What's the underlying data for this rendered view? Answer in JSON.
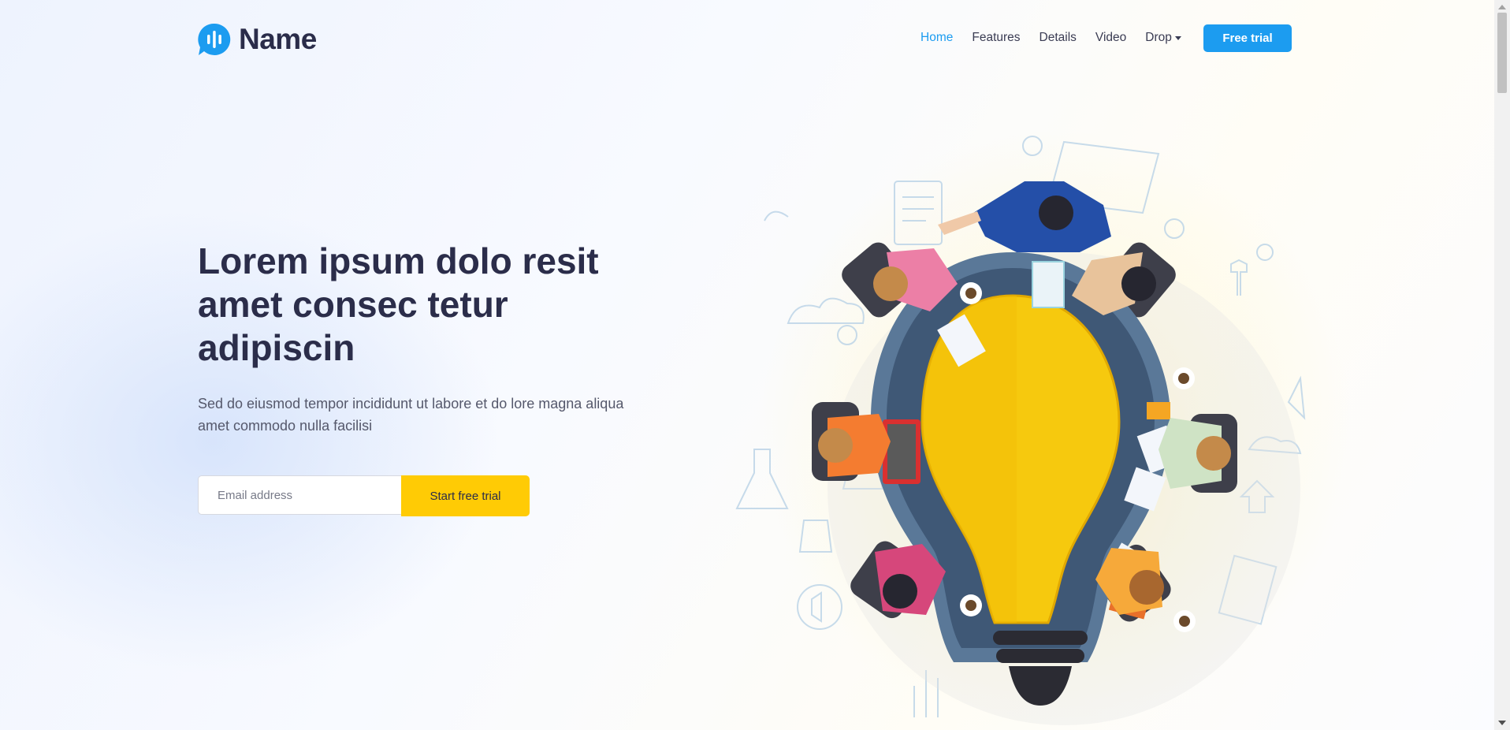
{
  "brand": {
    "name": "Name",
    "icon": "sound-bars-chat-bubble-icon",
    "color": "#1c9cf0"
  },
  "nav": {
    "items": [
      {
        "label": "Home",
        "active": true
      },
      {
        "label": "Features"
      },
      {
        "label": "Details"
      },
      {
        "label": "Video"
      },
      {
        "label": "Drop",
        "dropdown": true
      }
    ],
    "cta": "Free trial"
  },
  "hero": {
    "title": "Lorem ipsum dolo resit amet consec tetur adipiscin",
    "subtitle": "Sed do eiusmod tempor incididunt ut labore et do lore magna aliqua amet commodo nulla facilisi",
    "email_placeholder": "Email address",
    "cta": "Start free trial",
    "illustration": "team-meeting-around-lightbulb-table"
  },
  "colors": {
    "primary": "#1c9cf0",
    "accent": "#ffcb05",
    "heading": "#2b2d4a",
    "body_text": "#55586b"
  }
}
